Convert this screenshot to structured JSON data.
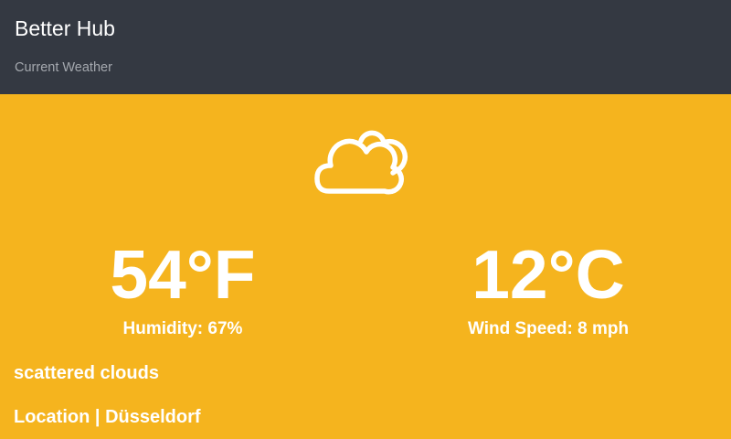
{
  "header": {
    "title": "Better Hub",
    "subtitle": "Current Weather"
  },
  "weather": {
    "icon": "scattered-clouds-icon",
    "temp_f": "54°F",
    "temp_c": "12°C",
    "humidity": "Humidity: 67%",
    "wind": "Wind Speed: 8 mph",
    "description": "scattered clouds",
    "location_label": "Location",
    "separator": "|",
    "location": "Düsseldorf"
  },
  "colors": {
    "header_bg": "#343942",
    "accent_bg": "#F5B41E",
    "text": "#FFFFFF",
    "subtitle": "#A4A8AE"
  }
}
